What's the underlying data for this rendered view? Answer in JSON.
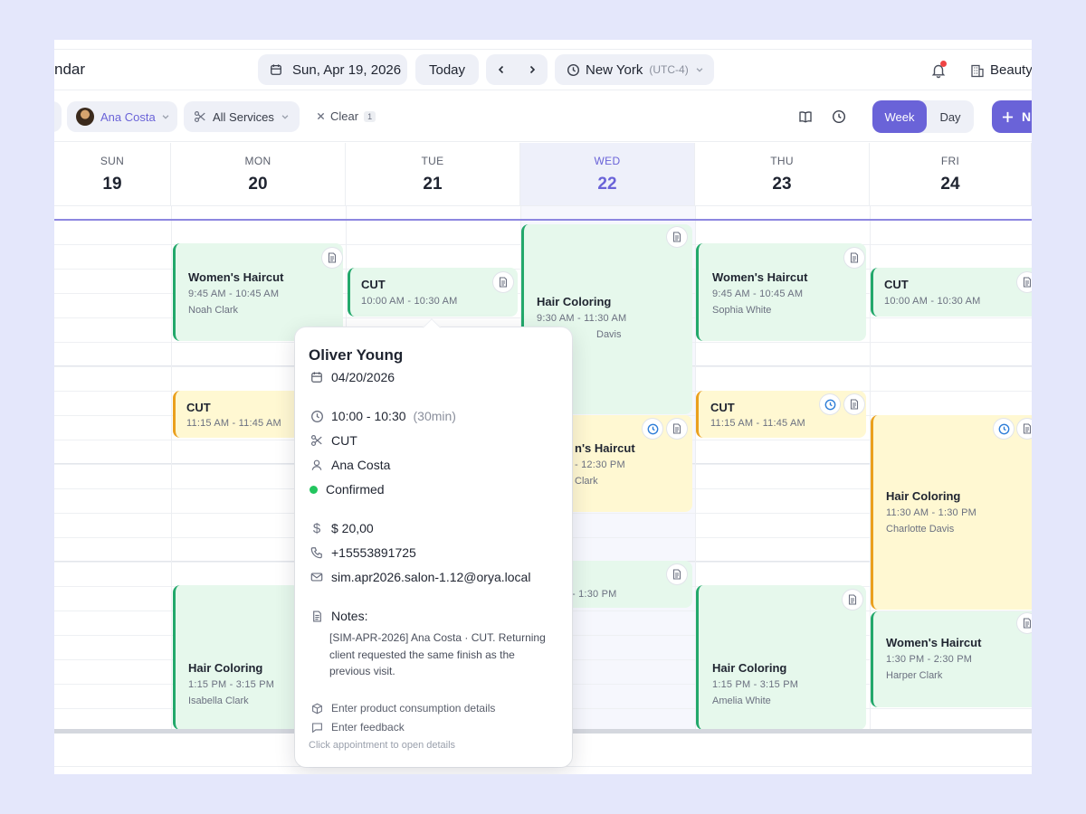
{
  "header": {
    "app_title": "ndar",
    "date": "Sun, Apr 19, 2026",
    "today_label": "Today",
    "timezone": "New York",
    "timezone_offset": "(UTC-4)",
    "salon_name": "Beauty",
    "icons": [
      "calendar-icon",
      "chevron-left-icon",
      "chevron-right-icon",
      "clock-icon",
      "chevron-down-icon",
      "bell-icon",
      "building-icon"
    ]
  },
  "filters": {
    "staff": "Ana Costa",
    "services": "All Services",
    "clear_label": "Clear",
    "clear_count": "1",
    "view_week": "Week",
    "view_day": "Day",
    "new_label": "N"
  },
  "days": [
    {
      "name": "SUN",
      "date": "19"
    },
    {
      "name": "MON",
      "date": "20"
    },
    {
      "name": "TUE",
      "date": "21"
    },
    {
      "name": "WED",
      "date": "22",
      "today": true
    },
    {
      "name": "THU",
      "date": "23"
    },
    {
      "name": "FRI",
      "date": "24"
    }
  ],
  "events": {
    "mon_haircut": {
      "title": "Women's Haircut",
      "time": "9:45 AM - 10:45 AM",
      "client": "Noah Clark"
    },
    "mon_cut": {
      "title": "CUT",
      "time": "11:15 AM - 11:45 AM"
    },
    "mon_coloring": {
      "title": "Hair Coloring",
      "time": "1:15 PM - 3:15 PM",
      "client": "Isabella Clark"
    },
    "tue_cut": {
      "title": "CUT",
      "time": "10:00 AM - 10:30 AM"
    },
    "wed_coloring": {
      "title": "Hair Coloring",
      "time": "9:30 AM - 11:30 AM",
      "client": "Davis"
    },
    "wed_haircut": {
      "title": "n's Haircut",
      "time": "- 12:30 PM",
      "client": "Clark"
    },
    "wed_third": {
      "time": "- 1:30 PM"
    },
    "thu_haircut": {
      "title": "Women's Haircut",
      "time": "9:45 AM - 10:45 AM",
      "client": "Sophia White"
    },
    "thu_cut": {
      "title": "CUT",
      "time": "11:15 AM - 11:45 AM"
    },
    "thu_coloring": {
      "title": "Hair Coloring",
      "time": "1:15 PM - 3:15 PM",
      "client": "Amelia White"
    },
    "fri_cut": {
      "title": "CUT",
      "time": "10:00 AM - 10:30 AM"
    },
    "fri_coloring": {
      "title": "Hair Coloring",
      "time": "11:30 AM - 1:30 PM",
      "client": "Charlotte Davis"
    },
    "fri_haircut": {
      "title": "Women's Haircut",
      "time": "1:30 PM - 2:30 PM",
      "client": "Harper Clark"
    }
  },
  "popover": {
    "client": "Oliver Young",
    "date": "04/20/2026",
    "time": "10:00 - 10:30",
    "duration": "(30min)",
    "service": "CUT",
    "staff": "Ana Costa",
    "status": "Confirmed",
    "status_color": "#22c55e",
    "price": "$ 20,00",
    "phone": "+15553891725",
    "email": "sim.apr2026.salon-1.12@orya.local",
    "notes_label": "Notes:",
    "notes": "[SIM-APR-2026] Ana Costa · CUT. Returning client requested the same finish as the previous visit.",
    "product_link": "Enter product consumption details",
    "feedback_link": "Enter feedback",
    "hint": "Click appointment to open details"
  },
  "colors": {
    "accent": "#6a63d8",
    "event_green": "#e6f8ec",
    "event_yellow": "#fff8d2",
    "bar_green": "#23a86b",
    "bar_orange": "#eaa01e"
  }
}
